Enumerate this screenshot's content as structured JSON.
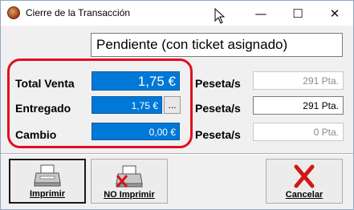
{
  "window": {
    "title": "Cierre de la Transacción",
    "controls": {
      "minimize": "—",
      "maximize": "☐",
      "close": "✕"
    }
  },
  "status": "Pendiente (con ticket asignado)",
  "fields": {
    "total_label": "Total Venta",
    "total_value": "1,75 €",
    "entregado_label": "Entregado",
    "entregado_value": "1,75 €",
    "dots_label": "...",
    "cambio_label": "Cambio",
    "cambio_value": "0,00 €"
  },
  "pesetas": {
    "label": "Peseta/s",
    "total": "291 Pta.",
    "entregado": "291 Pta.",
    "cambio": "0 Pta."
  },
  "buttons": {
    "imprimir": "Imprimir",
    "no_imprimir": "NO Imprimir",
    "cancelar": "Cancelar"
  },
  "colors": {
    "highlight_frame": "#e01020",
    "field_blue": "#0078d7",
    "cancel_x": "#d01818"
  }
}
